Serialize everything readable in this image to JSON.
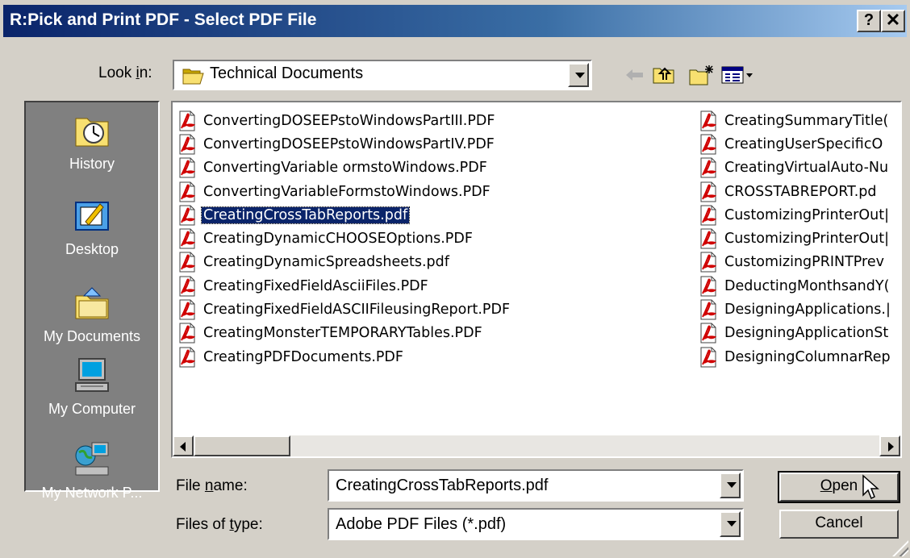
{
  "window": {
    "title": "R:Pick and Print PDF - Select PDF File",
    "help_button": "?",
    "close_button": "✕"
  },
  "look_in": {
    "label_pre": "Look ",
    "label_accel": "i",
    "label_post": "n:",
    "value": "Technical Documents",
    "folder_icon": "open-folder-icon"
  },
  "toolbar": {
    "back": "back-arrow-icon",
    "up": "up-one-level-icon",
    "new_folder": "new-folder-icon",
    "views": "views-menu-icon"
  },
  "places": [
    {
      "label": "History",
      "icon": "history-icon"
    },
    {
      "label": "Desktop",
      "icon": "desktop-icon"
    },
    {
      "label": "My Documents",
      "icon": "my-documents-icon"
    },
    {
      "label": "My Computer",
      "icon": "my-computer-icon"
    },
    {
      "label": "My Network P...",
      "icon": "my-network-places-icon"
    }
  ],
  "files_col1": [
    "ConvertingDOSEEPstoWindowsPartIII.PDF",
    "ConvertingDOSEEPstoWindowsPartIV.PDF",
    "ConvertingVariable ormstoWindows.PDF",
    "ConvertingVariableFormstoWindows.PDF",
    "CreatingCrossTabReports.pdf",
    "CreatingDynamicCHOOSEOptions.PDF",
    "CreatingDynamicSpreadsheets.pdf",
    "CreatingFixedFieldAsciiFiles.PDF",
    "CreatingFixedFieldASCIIFileusingReport.PDF",
    "CreatingMonsterTEMPORARYTables.PDF",
    "CreatingPDFDocuments.PDF"
  ],
  "files_col2": [
    "CreatingSummaryTitle(",
    "CreatingUserSpecificO",
    "CreatingVirtualAuto-Nu",
    "CROSSTABREPORT.pd",
    "CustomizingPrinterOut|",
    "CustomizingPrinterOut|",
    "CustomizingPRINTPrev",
    "DeductingMonthsandY(",
    "DesigningApplications.|",
    "DesigningApplicationSt",
    "DesigningColumnarRep"
  ],
  "selected_file": "CreatingCrossTabReports.pdf",
  "file_name": {
    "label_pre": "File ",
    "label_accel": "n",
    "label_post": "ame:",
    "value": "CreatingCrossTabReports.pdf"
  },
  "file_type": {
    "label_pre": "Files of ",
    "label_accel": "t",
    "label_post": "ype:",
    "value": "Adobe PDF Files (*.pdf)"
  },
  "buttons": {
    "open_accel": "O",
    "open_rest": "pen",
    "cancel": "Cancel"
  }
}
